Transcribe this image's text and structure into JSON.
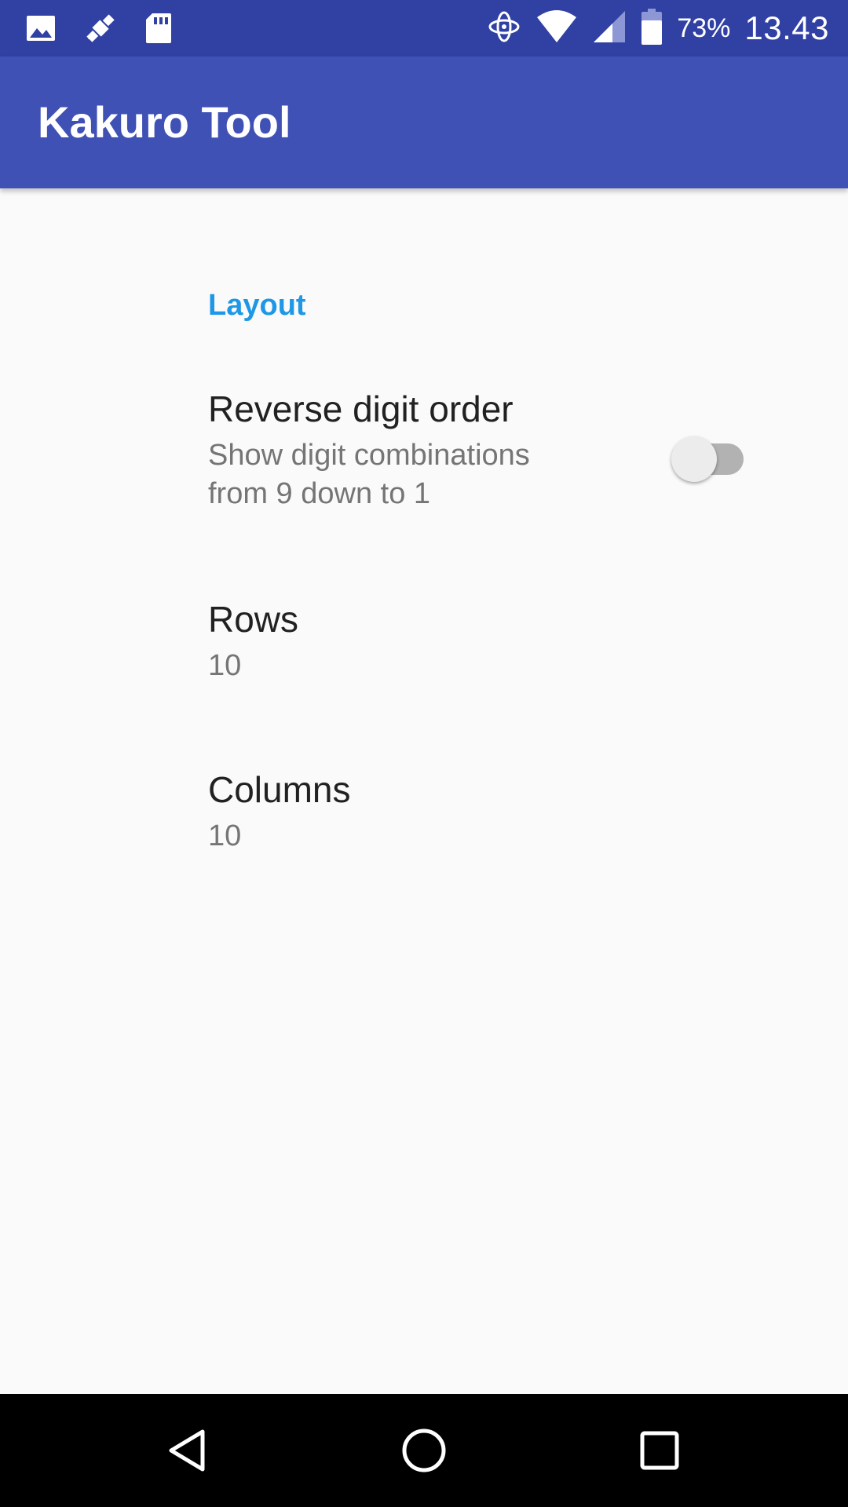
{
  "status_bar": {
    "icons_left": [
      "image-icon",
      "satellite-icon",
      "sd-card-icon"
    ],
    "icons_right": [
      "sync-icon",
      "wifi-icon",
      "signal-icon",
      "battery-icon"
    ],
    "battery_percent": "73%",
    "time": "13.43"
  },
  "app_bar": {
    "title": "Kakuro Tool"
  },
  "preferences": {
    "category": "Layout",
    "reverse": {
      "title": "Reverse digit order",
      "summary": "Show digit combinations from 9 down to 1",
      "enabled": false
    },
    "rows": {
      "title": "Rows",
      "value": "10"
    },
    "columns": {
      "title": "Columns",
      "value": "10"
    }
  },
  "nav_bar": {
    "icons": [
      "back-icon",
      "home-icon",
      "recents-icon"
    ]
  },
  "colors": {
    "status_bar": "#3140a3",
    "app_bar": "#3f51b5",
    "accent": "#1e98e6",
    "background": "#fafafa"
  }
}
